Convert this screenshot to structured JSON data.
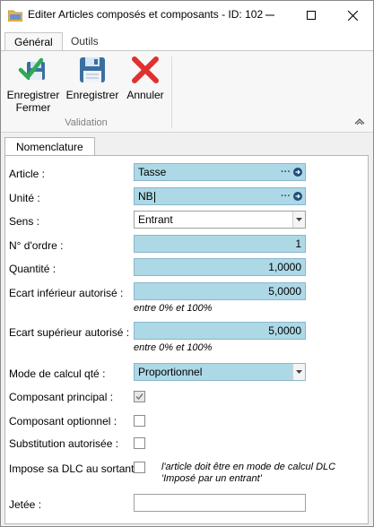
{
  "window": {
    "title": "Editer Articles composés et composants - ID: 102"
  },
  "ribbon": {
    "tabs": [
      {
        "label": "Général"
      },
      {
        "label": "Outils"
      }
    ],
    "buttons": {
      "save_close": "Enregistrer\nFermer",
      "save": "Enregistrer",
      "cancel": "Annuler"
    },
    "group_label": "Validation"
  },
  "content_tab": "Nomenclature",
  "form": {
    "article": {
      "label": "Article :",
      "value": "Tasse"
    },
    "unite": {
      "label": "Unité :",
      "value": "NB"
    },
    "sens": {
      "label": "Sens :",
      "value": "Entrant"
    },
    "numero_ordre": {
      "label": "N° d'ordre :",
      "value": "1"
    },
    "quantite": {
      "label": "Quantité :",
      "value": "1,0000"
    },
    "ecart_inf": {
      "label": "Ecart inférieur autorisé :",
      "value": "5,0000",
      "hint": "entre 0% et 100%"
    },
    "ecart_sup": {
      "label": "Ecart supérieur autorisé :",
      "value": "5,0000",
      "hint": "entre 0% et 100%"
    },
    "mode_calcul": {
      "label": "Mode de calcul qté :",
      "value": "Proportionnel"
    },
    "composant_principal": {
      "label": "Composant principal :",
      "checked": true
    },
    "composant_optionnel": {
      "label": "Composant optionnel :",
      "checked": false
    },
    "substitution": {
      "label": "Substitution autorisée :",
      "checked": false
    },
    "impose_dlc": {
      "label": "Impose sa DLC au sortant :",
      "checked": false,
      "note_line1": "l'article doit être en mode de calcul DLC",
      "note_line2": "'Imposé par un entrant'"
    },
    "jetee": {
      "label": "Jetée :",
      "value": ""
    }
  },
  "icons": {
    "app": "folder-icon",
    "save_close": "save-check-icon",
    "save": "floppy-disk-icon",
    "cancel": "red-x-icon",
    "lookup_dots": "ellipsis-icon",
    "lookup_go": "arrow-right-circle-icon",
    "dropdown": "chevron-down-icon",
    "collapse": "chevron-up-icon"
  },
  "colors": {
    "field_highlight": "#add8e6",
    "accent_blue": "#1f4e79",
    "cancel_red": "#e03030",
    "check_green": "#2eaa55"
  }
}
